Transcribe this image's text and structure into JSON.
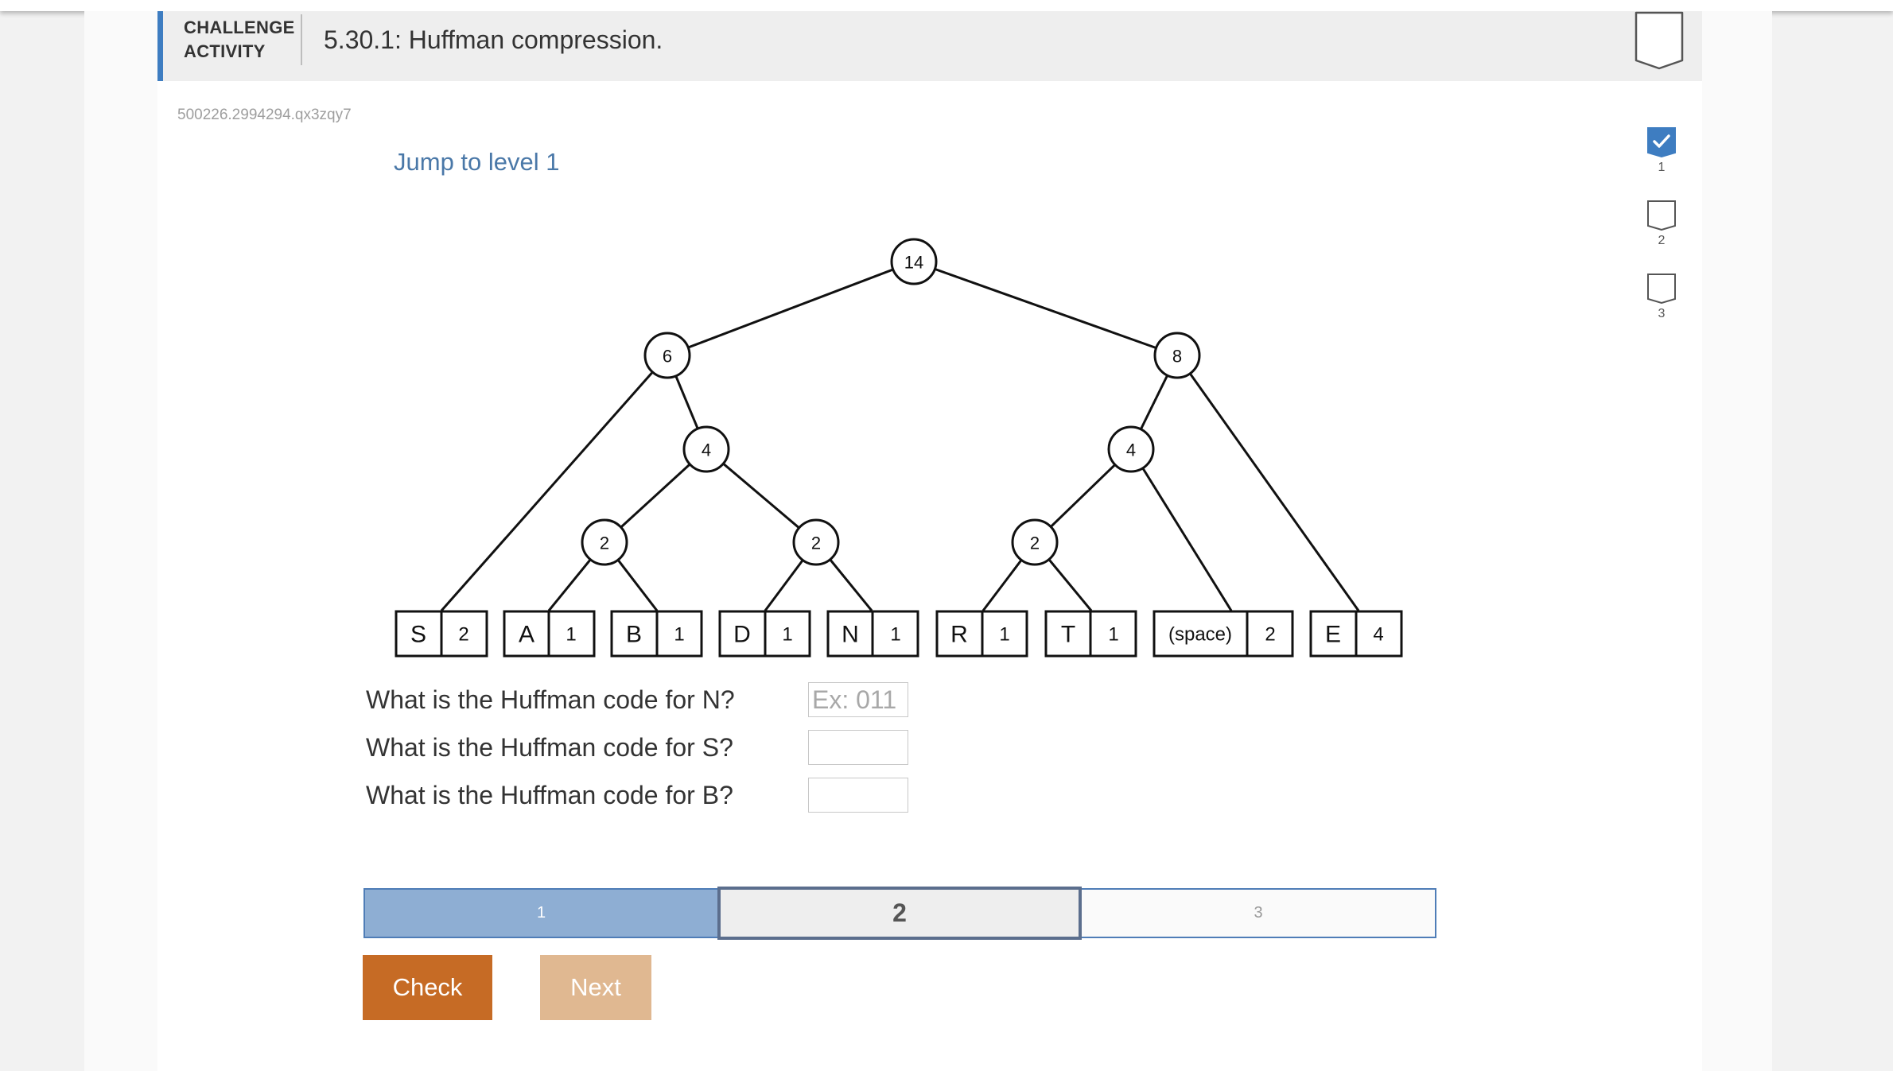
{
  "header": {
    "challenge_label": "CHALLENGE ACTIVITY",
    "title": "5.30.1: Huffman compression.",
    "accent_color": "#3e7dc1",
    "badge_icon": "shield-badge-icon"
  },
  "activity_id": "500226.2994294.qx3zqy7",
  "jump_link": "Jump to level 1",
  "levels": [
    {
      "label": "1",
      "completed": true
    },
    {
      "label": "2",
      "completed": false
    },
    {
      "label": "3",
      "completed": false
    }
  ],
  "tree": {
    "internal_nodes": {
      "root": "14",
      "left": "6",
      "right": "8",
      "left_inner": "4",
      "right_inner": "4",
      "left_inner_left": "2",
      "left_inner_right": "2",
      "right_inner_left": "2"
    },
    "leaves": [
      {
        "symbol": "S",
        "freq": "2"
      },
      {
        "symbol": "A",
        "freq": "1"
      },
      {
        "symbol": "B",
        "freq": "1"
      },
      {
        "symbol": "D",
        "freq": "1"
      },
      {
        "symbol": "N",
        "freq": "1"
      },
      {
        "symbol": "R",
        "freq": "1"
      },
      {
        "symbol": "T",
        "freq": "1"
      },
      {
        "symbol": "(space)",
        "freq": "2"
      },
      {
        "symbol": "E",
        "freq": "4"
      }
    ]
  },
  "questions": [
    {
      "text": "What is the Huffman code for N?",
      "placeholder": "Ex: 011",
      "value": ""
    },
    {
      "text": "What is the Huffman code for S?",
      "placeholder": "",
      "value": ""
    },
    {
      "text": "What is the Huffman code for B?",
      "placeholder": "",
      "value": ""
    }
  ],
  "progress": {
    "segments": [
      "1",
      "2",
      "3"
    ],
    "current": "2",
    "completed_color": "#8eaed3"
  },
  "buttons": {
    "check": "Check",
    "next": "Next",
    "check_color": "#c66b25",
    "next_color": "#e0b891"
  }
}
